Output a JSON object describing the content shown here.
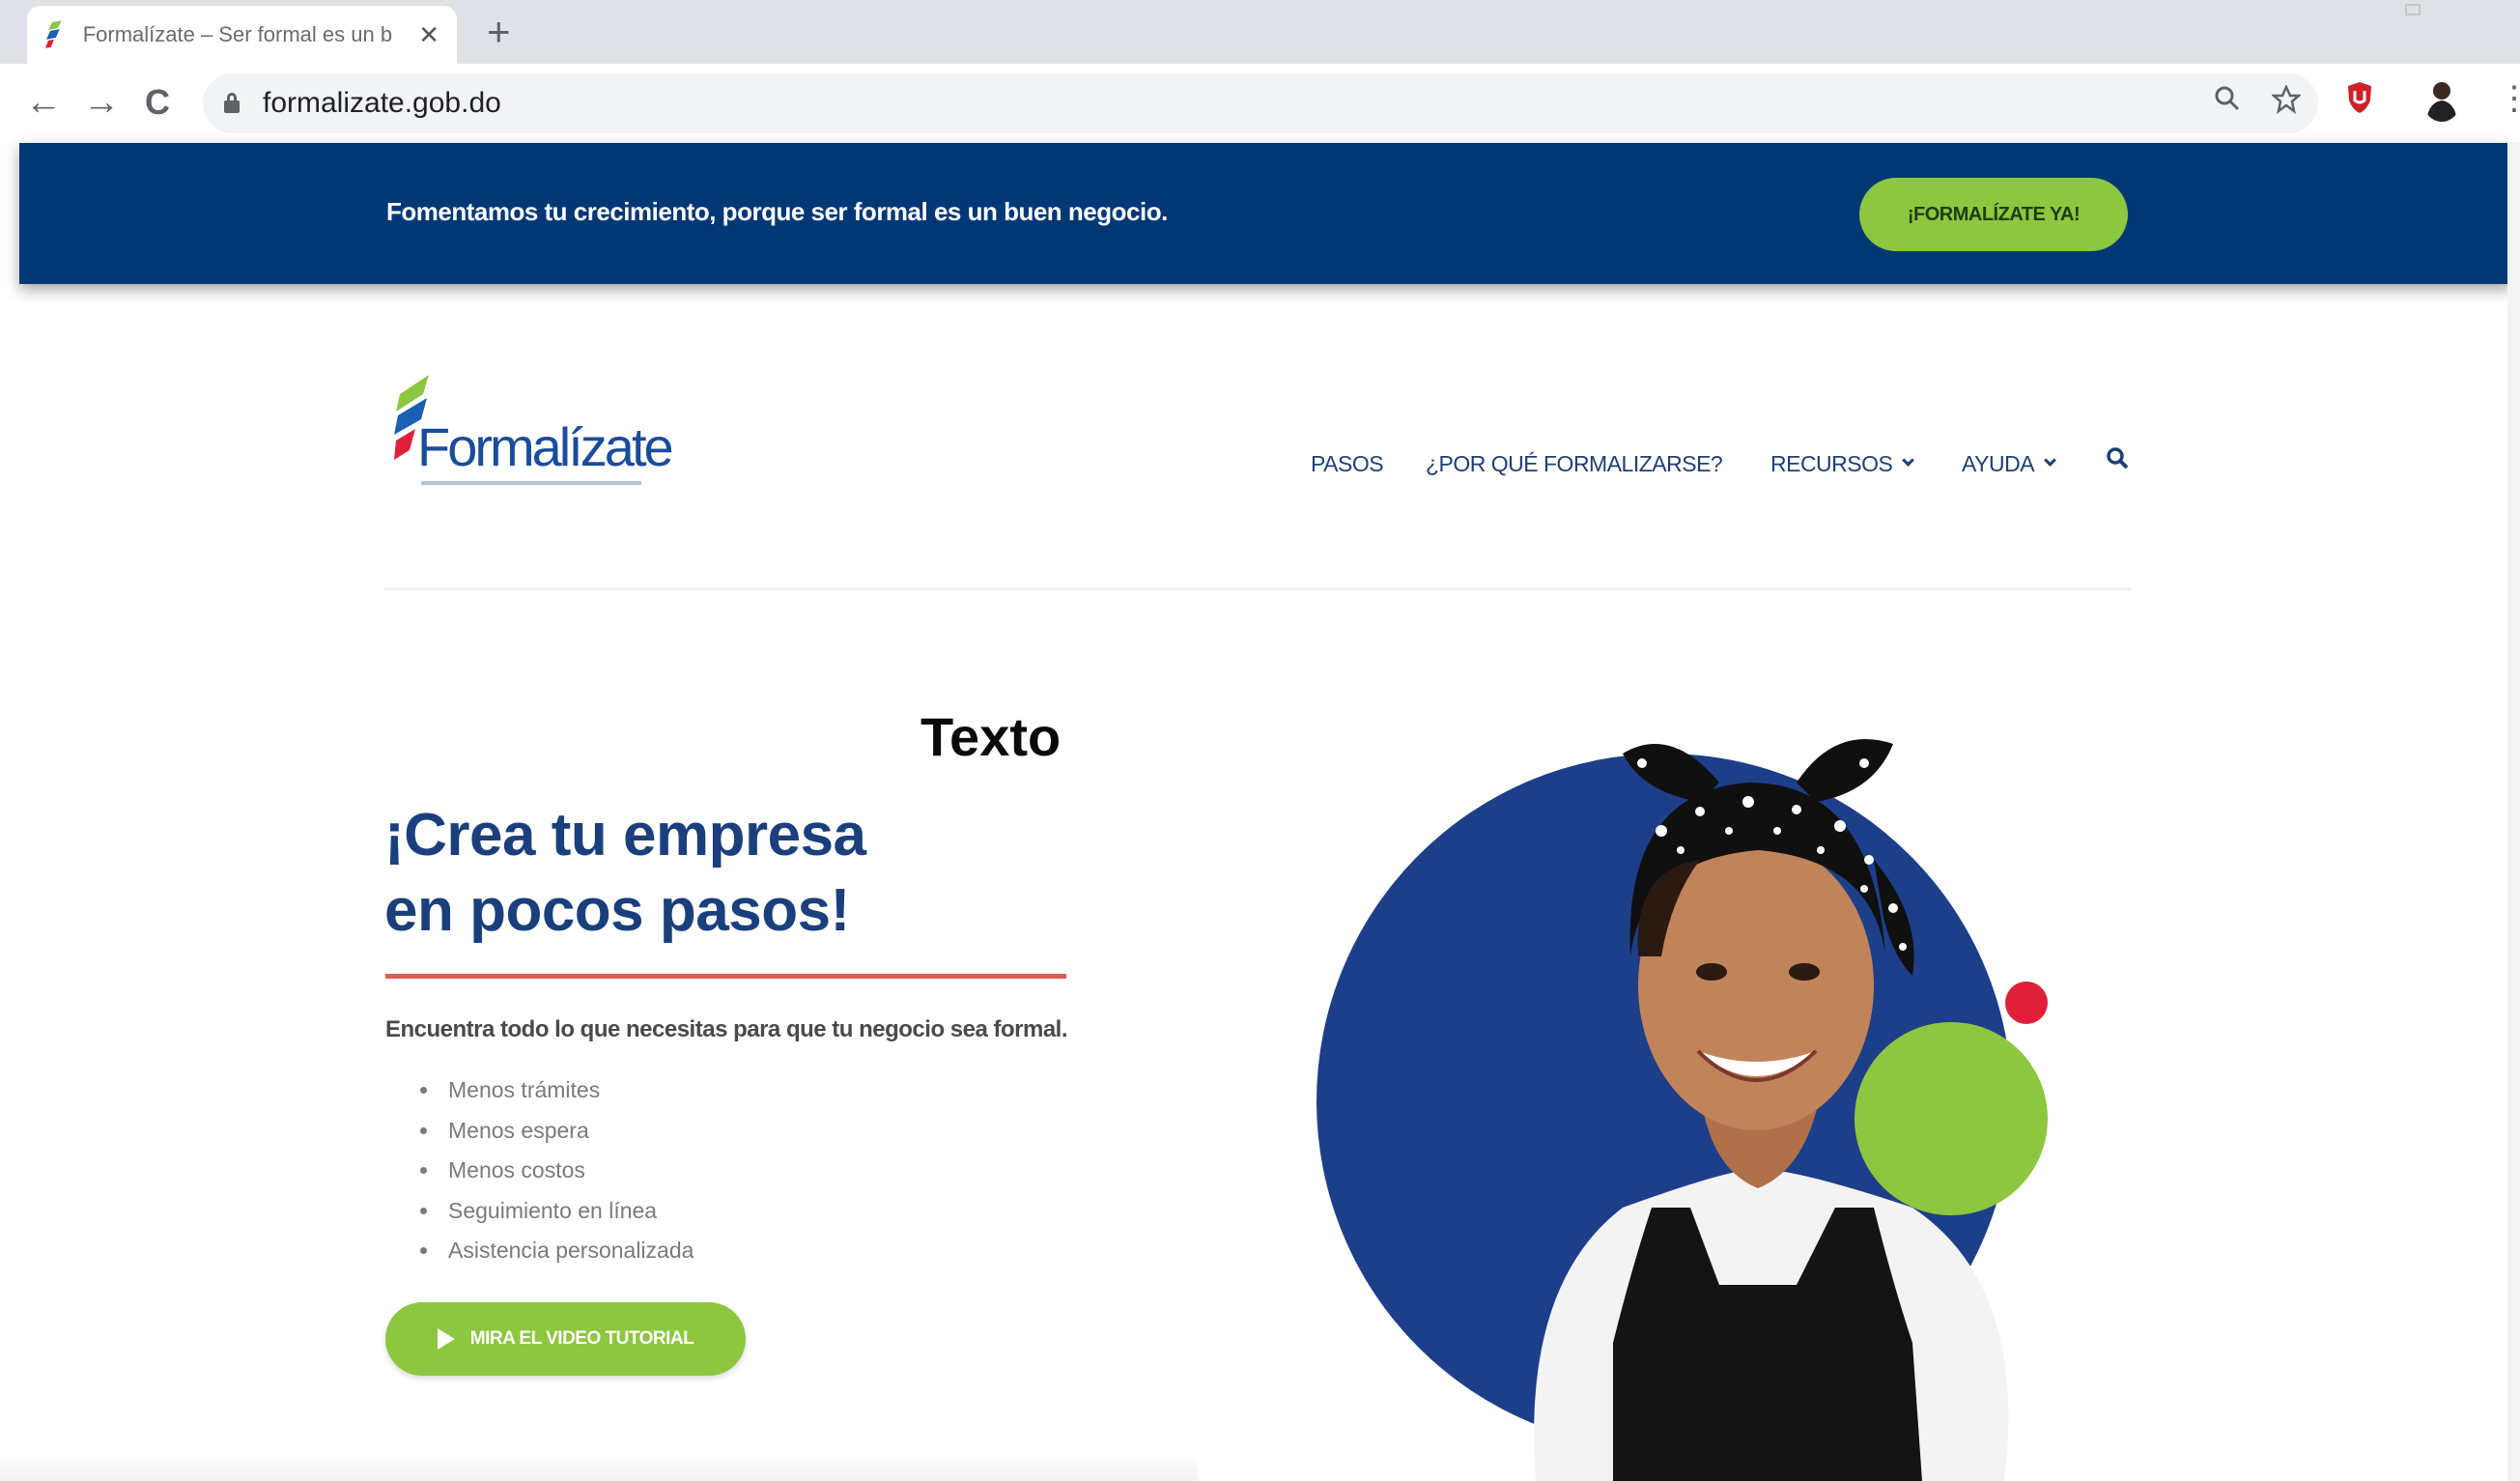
{
  "browser": {
    "tab_title": "Formalízate – Ser formal es un b",
    "tab_close": "✕",
    "new_tab": "+",
    "url": "formalizate.gob.do",
    "back": "←",
    "forward": "→",
    "reload": "C",
    "menu": "⋮",
    "icons": [
      "favicon-icon",
      "back-arrow-icon",
      "forward-arrow-icon",
      "reload-icon",
      "lock-icon",
      "zoom-icon",
      "star-icon",
      "shield-extension-icon",
      "profile-avatar-icon",
      "menu-dots-icon"
    ]
  },
  "banner": {
    "text": "Fomentamos tu crecimiento, porque ser formal es un buen negocio.",
    "button": "¡FORMALÍZATE YA!",
    "background": "#003876",
    "button_color": "#8dc63f"
  },
  "logo": {
    "text": "Formalízate"
  },
  "nav": {
    "items": [
      {
        "label": "PASOS"
      },
      {
        "label": "¿POR QUÉ FORMALIZARSE?"
      },
      {
        "label": "RECURSOS"
      },
      {
        "label": "AYUDA"
      }
    ]
  },
  "overlay": {
    "label": "Texto"
  },
  "hero": {
    "title_line1": "¡Crea tu empresa",
    "title_line2": "en pocos pasos!",
    "subtitle": "Encuentra todo lo que necesitas para que tu negocio sea formal.",
    "bullets": [
      "Menos trámites",
      "Menos espera",
      "Menos costos",
      "Seguimiento en línea",
      "Asistencia personalizada"
    ],
    "video_button": "MIRA EL VIDEO TUTORIAL",
    "title_color": "#1a3f7c",
    "rule_color": "#e05a5a",
    "circle_color": "#1d3f8a",
    "accent_green": "#8dc63f",
    "accent_red": "#e0203a"
  }
}
